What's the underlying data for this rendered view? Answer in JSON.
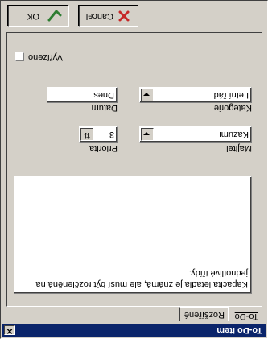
{
  "window": {
    "title": "To-Do Item",
    "close_glyph": "✕"
  },
  "tabs": [
    {
      "label": "To-Do"
    },
    {
      "label": "Rozšířené"
    }
  ],
  "memo": {
    "text": "Kapacita letadla je známá, ale musí být rozčleněná na jednotlivé třídy."
  },
  "fields": {
    "owner_label": "Majitel",
    "owner_value": "Kazumi",
    "priority_label": "Priorita",
    "priority_value": "3",
    "category_label": "Kategorie",
    "category_value": "Letní řád",
    "date_label": "Datum",
    "date_value": "Dnes"
  },
  "done": {
    "label": "Vyřízeno",
    "checked": false
  },
  "buttons": {
    "ok": "OK",
    "cancel": "Cancel"
  },
  "icons": {
    "ok": "check-icon",
    "cancel": "x-icon",
    "spin": "up-down-arrows-icon",
    "dropdown": "chevron-down-icon"
  },
  "colors": {
    "titlebar": "#0a246a",
    "ok_icon": "#2e7d32",
    "cancel_icon": "#c62828"
  }
}
